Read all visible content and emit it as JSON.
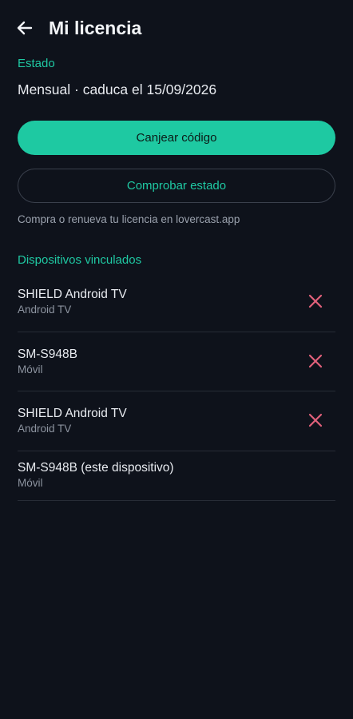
{
  "header": {
    "title": "Mi licencia",
    "back_icon": "arrow-left-icon"
  },
  "status": {
    "label": "Estado",
    "value": "Mensual · caduca el 15/09/2026"
  },
  "actions": {
    "redeem_label": "Canjear código",
    "check_label": "Comprobar estado",
    "hint": "Compra o renueva tu licencia en lovercast.app"
  },
  "devices": {
    "label": "Dispositivos vinculados",
    "items": [
      {
        "name": "SHIELD Android TV",
        "type": "Android TV",
        "removable": true
      },
      {
        "name": "SM-S948B",
        "type": "Móvil",
        "removable": true
      },
      {
        "name": "SHIELD Android TV",
        "type": "Android TV",
        "removable": true
      },
      {
        "name": "SM-S948B (este dispositivo)",
        "type": "Móvil",
        "removable": false
      }
    ]
  },
  "colors": {
    "background": "#0e121b",
    "accent": "#1ec9a2",
    "remove": "#e0607a",
    "divider": "#272c36"
  }
}
